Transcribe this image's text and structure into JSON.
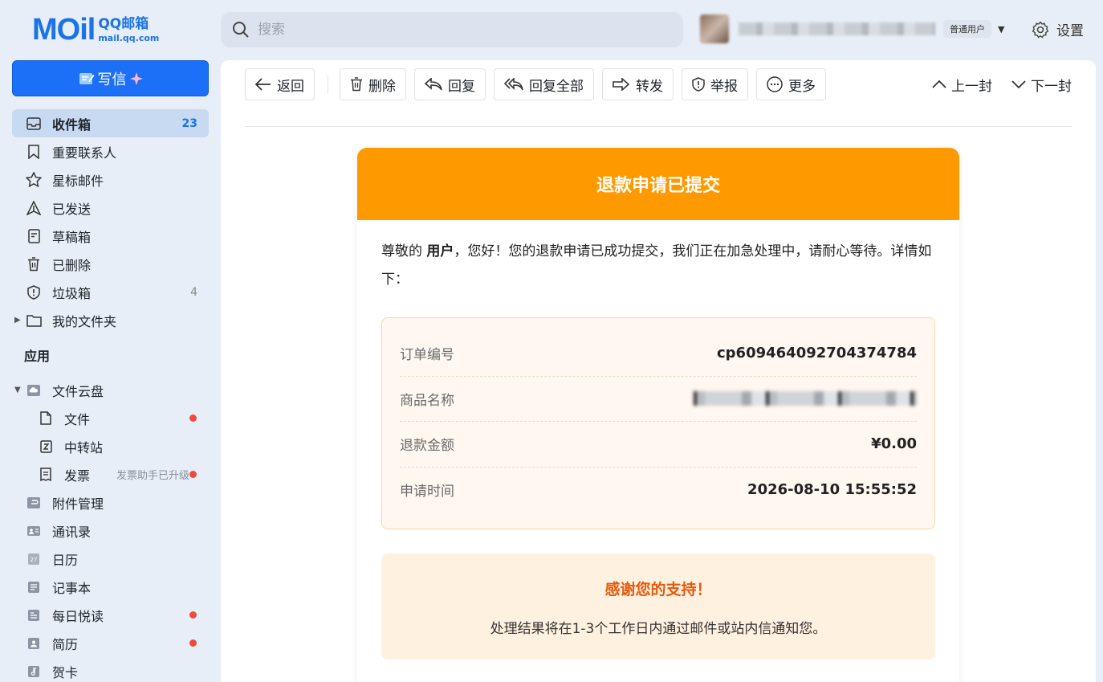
{
  "app": {
    "logo_mark": "MOil",
    "logo_title": "QQ邮箱",
    "logo_domain": "mail.qq.com"
  },
  "search": {
    "placeholder": "搜索"
  },
  "user": {
    "badge": "普通用户"
  },
  "settings_label": "设置",
  "compose_label": "写信",
  "nav": [
    {
      "label": "收件箱",
      "count": "23",
      "icon": "inbox-icon"
    },
    {
      "label": "重要联系人",
      "icon": "bookmark-icon"
    },
    {
      "label": "星标邮件",
      "icon": "star-icon"
    },
    {
      "label": "已发送",
      "icon": "send-icon"
    },
    {
      "label": "草稿箱",
      "icon": "draft-icon"
    },
    {
      "label": "已删除",
      "icon": "trash-icon"
    },
    {
      "label": "垃圾箱",
      "count": "4",
      "icon": "shield-icon"
    },
    {
      "label": "我的文件夹",
      "icon": "folder-icon"
    }
  ],
  "apps_title": "应用",
  "apps": [
    {
      "label": "文件云盘"
    },
    {
      "label": "文件"
    },
    {
      "label": "中转站"
    },
    {
      "label": "发票",
      "hint": "发票助手已升级"
    },
    {
      "label": "附件管理"
    },
    {
      "label": "通讯录"
    },
    {
      "label": "日历"
    },
    {
      "label": "记事本"
    },
    {
      "label": "每日悦读"
    },
    {
      "label": "简历"
    },
    {
      "label": "贺卡"
    }
  ],
  "toolbar": {
    "back": "返回",
    "delete": "删除",
    "reply": "回复",
    "reply_all": "回复全部",
    "forward": "转发",
    "report": "举报",
    "more": "更多",
    "prev": "上一封",
    "next": "下一封"
  },
  "email": {
    "header": "退款申请已提交",
    "greeting_prefix": "尊敬的 ",
    "greeting_name": "用户",
    "greeting_body": "，您好！您的退款申请已成功提交，我们正在加急处理中，请耐心等待。详情如下：",
    "details": [
      {
        "key": "订单编号",
        "value": "cp609464092704374784"
      },
      {
        "key": "商品名称",
        "value": ""
      },
      {
        "key": "退款金额",
        "value": "¥0.00"
      },
      {
        "key": "申请时间",
        "value": "2026-08-10 15:55:52"
      }
    ],
    "thanks_title": "感谢您的支持！",
    "thanks_body": "处理结果将在1-3个工作日内通过邮件或站内信通知您。"
  },
  "colors": {
    "brand_blue": "#1c6ff7",
    "header_orange": "#ff9900",
    "thanks_orange": "#e8590c",
    "unread_dot": "#ef4b3c"
  }
}
